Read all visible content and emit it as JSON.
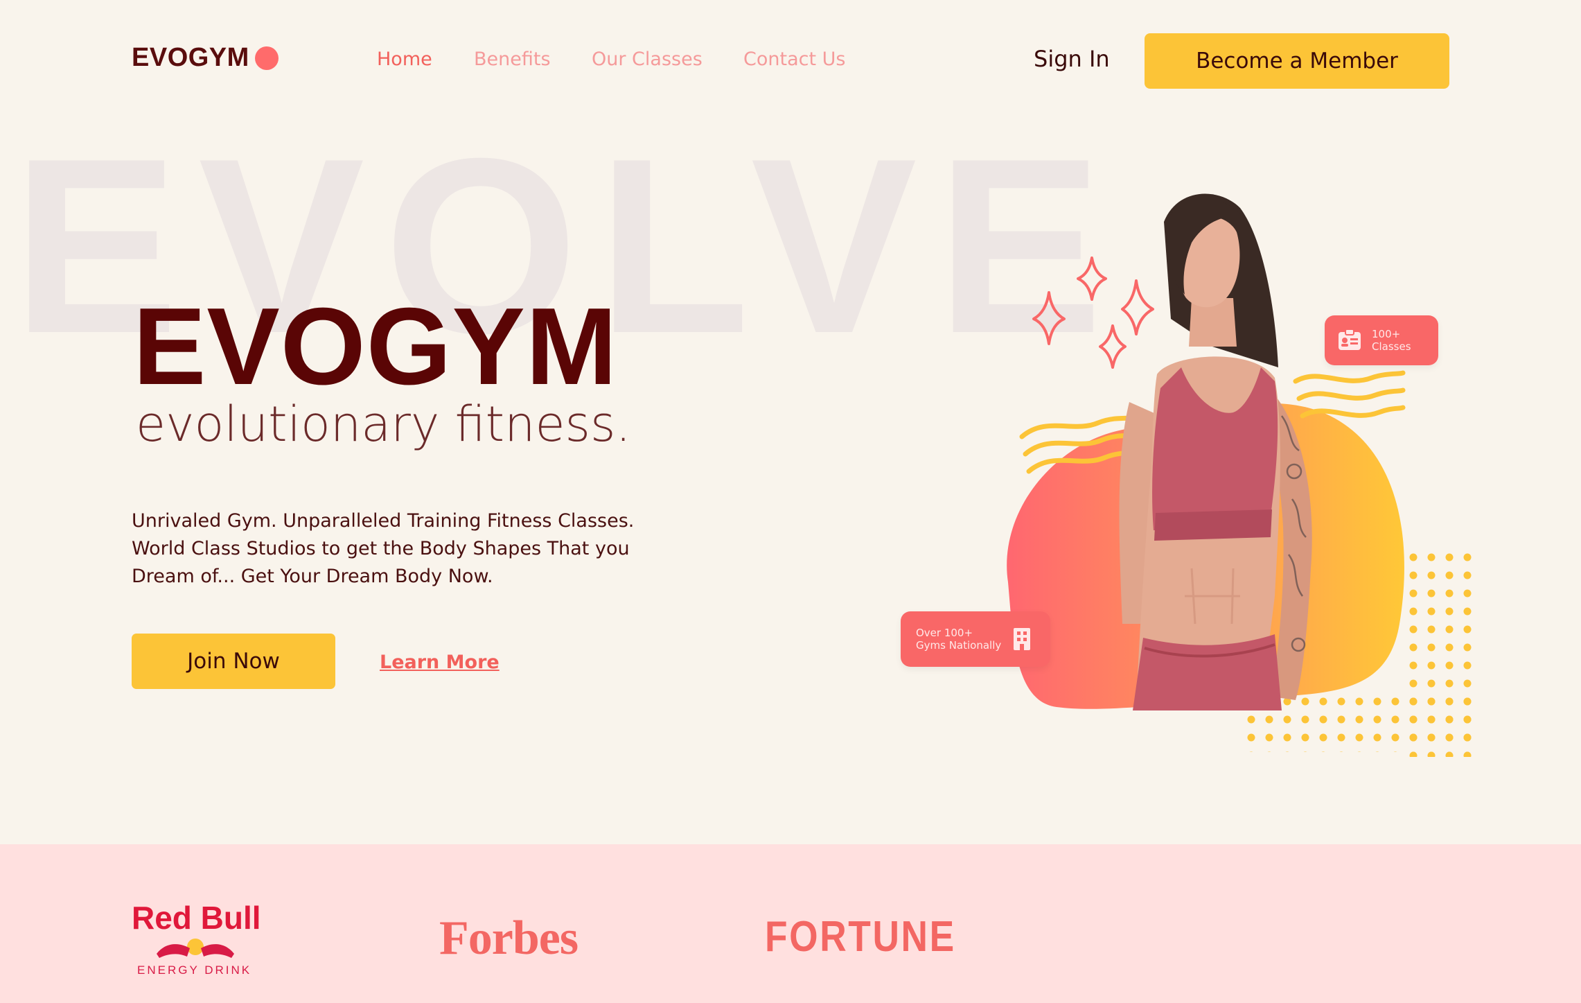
{
  "brand": {
    "name": "EVOGYM",
    "accent": "#ff6b6b",
    "dark": "#5a0505",
    "cta": "#fcc437"
  },
  "nav": {
    "links": [
      "Home",
      "Benefits",
      "Our Classes",
      "Contact Us"
    ],
    "sign_in": "Sign In",
    "member_cta": "Become a Member"
  },
  "hero": {
    "background_word": "EVOLVE",
    "title": "EVOGYM",
    "subtitle": "evolutionary fitness.",
    "description": "Unrivaled Gym. Unparalleled Training Fitness Classes. World Class Studios to get the Body Shapes That you Dream of... Get Your Dream Body Now.",
    "join_label": "Join Now",
    "learn_label": "Learn More"
  },
  "badges": {
    "classes": {
      "line1": "100+",
      "line2": "Classes",
      "icon": "id-card-icon"
    },
    "gyms": {
      "line1": "Over 100+",
      "line2": "Gyms Nationally",
      "icon": "building-icon"
    }
  },
  "partners": {
    "redbull": {
      "name": "Red Bull",
      "tagline": "ENERGY DRINK"
    },
    "forbes": "Forbes",
    "fortune": "FORTUNE"
  }
}
